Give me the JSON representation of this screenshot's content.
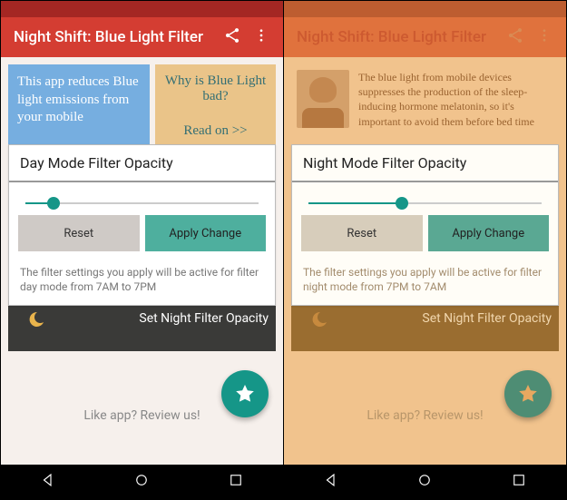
{
  "left": {
    "appbar": {
      "title": "Night Shift: Blue Light Filter"
    },
    "cardBlue": "This app reduces Blue light emissions from your mobile",
    "cardOrange": {
      "q": "Why is Blue Light bad?",
      "link": "Read on >>"
    },
    "panel": {
      "title": "Day Mode Filter Opacity",
      "sliderPercent": 12,
      "reset": "Reset",
      "apply": "Apply Change",
      "note": "The filter settings you apply will be active for filter day mode from 7AM to 7PM"
    },
    "nightStrip": "Set Night Filter Opacity",
    "review": "Like app? Review us!"
  },
  "right": {
    "appbar": {
      "title": "Night Shift: Blue Light Filter"
    },
    "infoText": "The blue light from mobile devices suppresses the production of the sleep-inducing hormone melatonin, so it's important to avoid them before bed time",
    "panel": {
      "title": "Night Mode Filter Opacity",
      "sliderPercent": 40,
      "reset": "Reset",
      "apply": "Apply Change",
      "note": "The filter settings you apply will be active for filter night mode from 7PM to 7AM"
    },
    "nightStrip": "Set Night Filter Opacity",
    "review": "Like app? Review us!"
  }
}
